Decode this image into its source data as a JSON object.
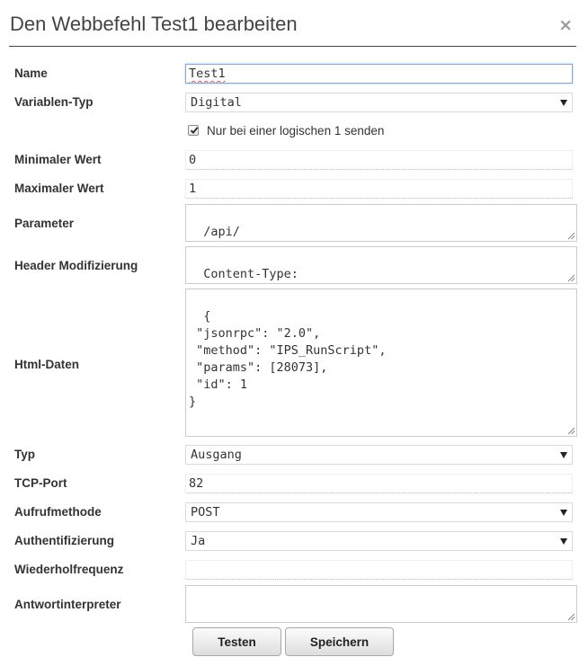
{
  "dialog": {
    "title": "Den Webbefehl Test1 bearbeiten",
    "close_symbol": "×"
  },
  "form": {
    "name": {
      "label": "Name",
      "value": "Test1"
    },
    "variablen_typ": {
      "label": "Variablen-Typ",
      "selected": "Digital"
    },
    "nur_logische_1": {
      "label": "Nur bei einer logischen 1 senden",
      "checked": true
    },
    "minimaler_wert": {
      "label": "Minimaler Wert",
      "value": "0"
    },
    "maximaler_wert": {
      "label": "Maximaler Wert",
      "value": "1"
    },
    "parameter": {
      "label": "Parameter",
      "value": "/api/"
    },
    "header_modifizierung": {
      "label": "Header Modifizierung",
      "value": "Content-Type:"
    },
    "html_daten": {
      "label": "Html-Daten",
      "value": "{\n \"jsonrpc\": \"2.0\",\n \"method\": \"IPS_RunScript\",\n \"params\": [28073],\n \"id\": 1\n}"
    },
    "typ": {
      "label": "Typ",
      "selected": "Ausgang"
    },
    "tcp_port": {
      "label": "TCP-Port",
      "value": "82"
    },
    "aufrufmethode": {
      "label": "Aufrufmethode",
      "selected": "POST"
    },
    "authentifizierung": {
      "label": "Authentifizierung",
      "selected": "Ja"
    },
    "wiederholfrequenz": {
      "label": "Wiederholfrequenz",
      "value": ""
    },
    "antwortinterpreter": {
      "label": "Antwortinterpreter",
      "value": ""
    }
  },
  "buttons": {
    "test_label": "Testen",
    "save_label": "Speichern"
  },
  "icons": {
    "close": "close-icon",
    "dropdown": "chevron-down-icon",
    "check": "check-icon",
    "resize": "resize-grip-icon"
  },
  "colors": {
    "title_rule": "#444444",
    "active_field_border": "#80a8d8",
    "spellcheck_underline": "#e05050"
  }
}
